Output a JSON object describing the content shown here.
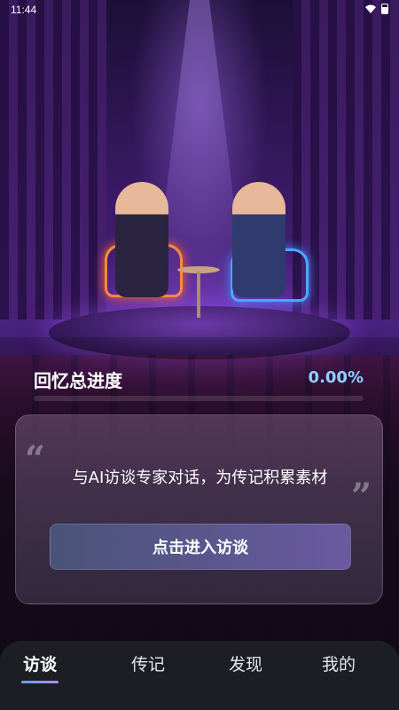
{
  "status_bar": {
    "time": "11:44"
  },
  "progress": {
    "title": "回忆总进度",
    "value_text": "0.00%",
    "percent": 0
  },
  "card": {
    "quote_open": "“",
    "quote_close": "”",
    "text": "与AI访谈专家对话，为传记积累素材",
    "button_label": "点击进入访谈"
  },
  "bottom_nav": {
    "items": [
      {
        "label": "访谈",
        "active": true
      },
      {
        "label": "传记",
        "active": false
      },
      {
        "label": "发现",
        "active": false
      },
      {
        "label": "我的",
        "active": false
      }
    ]
  },
  "colors": {
    "accent": "#8fd0ff",
    "nav_bg": "#1c1e24",
    "button_start": "#4a5378",
    "button_end": "#6a5aa0"
  }
}
